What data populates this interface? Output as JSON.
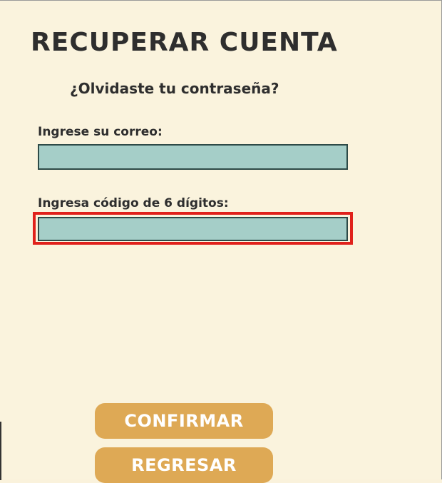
{
  "heading": {
    "title": "RECUPERAR CUENTA",
    "subtitle": "¿Olvidaste tu contraseña?"
  },
  "form": {
    "email_label": "Ingrese su correo:",
    "email_value": "",
    "code_label": "Ingresa código de 6 dígitos:",
    "code_value": ""
  },
  "actions": {
    "confirm_label": "CONFIRMAR",
    "back_label": "REGRESAR"
  },
  "colors": {
    "background": "#faf3dd",
    "input_fill": "#a5cec8",
    "button": "#dea955",
    "focus_highlight": "#e0211b",
    "text": "#2e2e2e"
  }
}
